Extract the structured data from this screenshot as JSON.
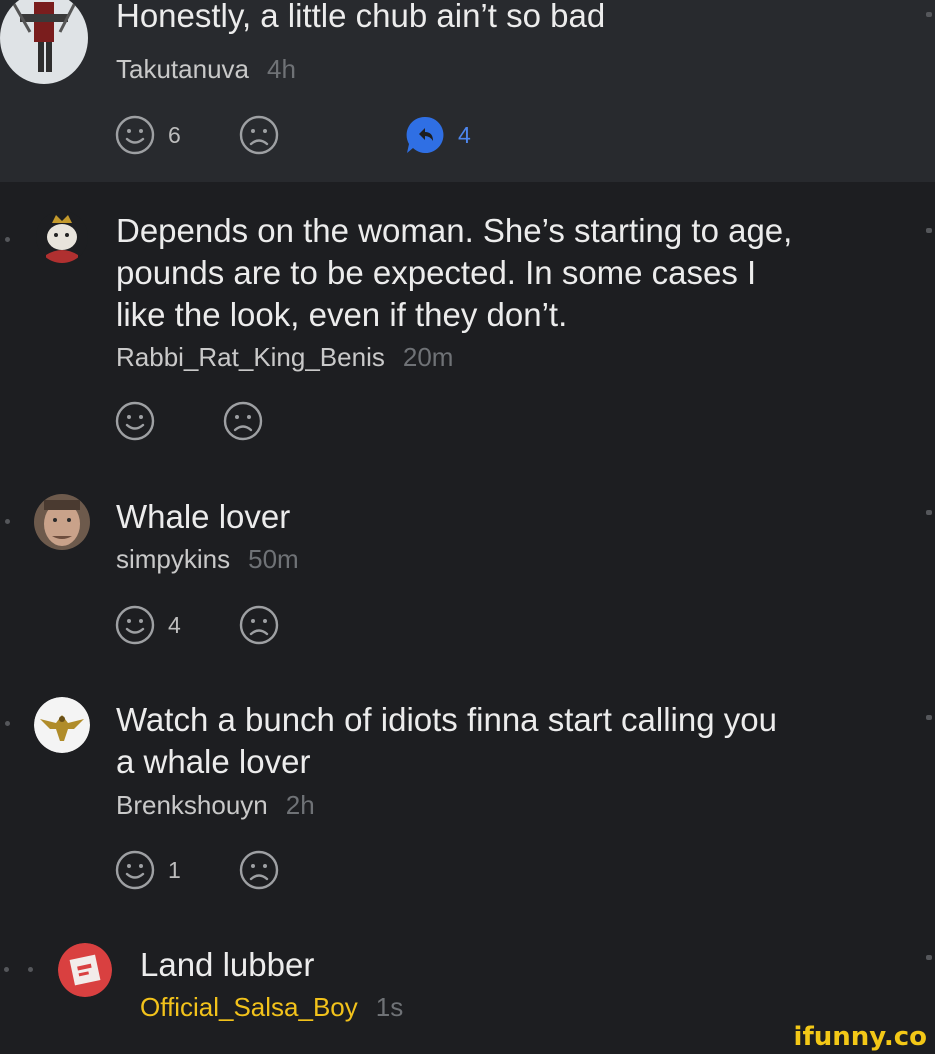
{
  "comments": [
    {
      "text": "Honestly, a little chub ain’t so bad",
      "author": "Takutanuva",
      "time": "4h",
      "smile_count": "6",
      "reply_count": "4"
    },
    {
      "text": "Depends on the woman. She’s starting to age,\npounds are to be expected. In some cases I\nlike the look, even if they don’t.",
      "author": "Rabbi_Rat_King_Benis",
      "time": "20m",
      "smile_count": ""
    },
    {
      "text": "Whale lover",
      "author": "simpykins",
      "time": "50m",
      "smile_count": "4"
    },
    {
      "text": "Watch a bunch of idiots finna start calling you\na whale lover",
      "author": "Brenkshouyn",
      "time": "2h",
      "smile_count": "1"
    },
    {
      "text": "Land lubber",
      "author": "Official_Salsa_Boy",
      "time": "1s"
    }
  ],
  "watermark": "ifunny.co",
  "colors": {
    "background": "#1d1e21",
    "parent_background": "#282a2e",
    "reply_accent": "#4d86ee",
    "highlight_author": "#f2c21b"
  }
}
